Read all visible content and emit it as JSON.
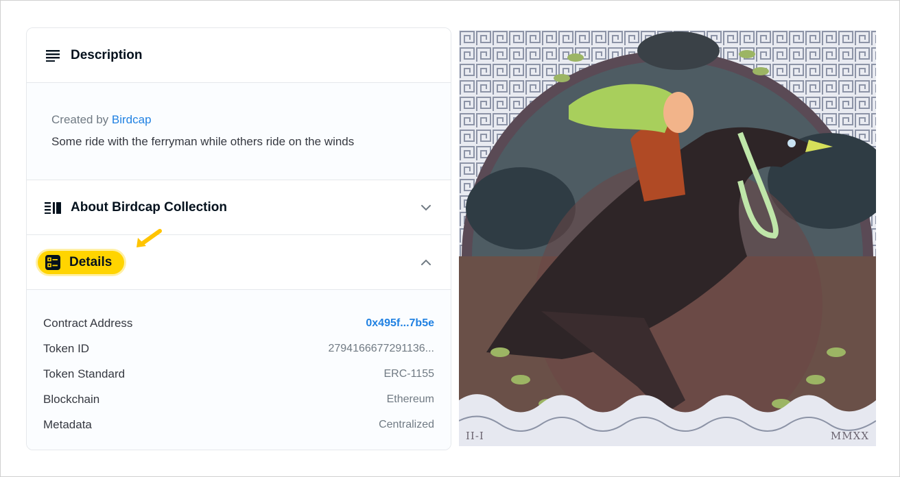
{
  "description": {
    "title": "Description",
    "created_by_label": "Created by",
    "creator": "Birdcap",
    "text": "Some ride with the ferryman while others ride on the winds"
  },
  "about": {
    "title": "About Birdcap Collection"
  },
  "details": {
    "title": "Details",
    "rows": [
      {
        "key": "Contract Address",
        "value": "0x495f...7b5e"
      },
      {
        "key": "Token ID",
        "value": "279416667729​1136..."
      },
      {
        "key": "Token Standard",
        "value": "ERC-1155"
      },
      {
        "key": "Blockchain",
        "value": "Ethereum"
      },
      {
        "key": "Metadata",
        "value": "Centralized"
      }
    ]
  },
  "artwork": {
    "caption_left": "II-I",
    "caption_right": "MMXX"
  },
  "colors": {
    "accent": "#ffd400",
    "link": "#2081e2",
    "border": "#e5e8eb"
  }
}
